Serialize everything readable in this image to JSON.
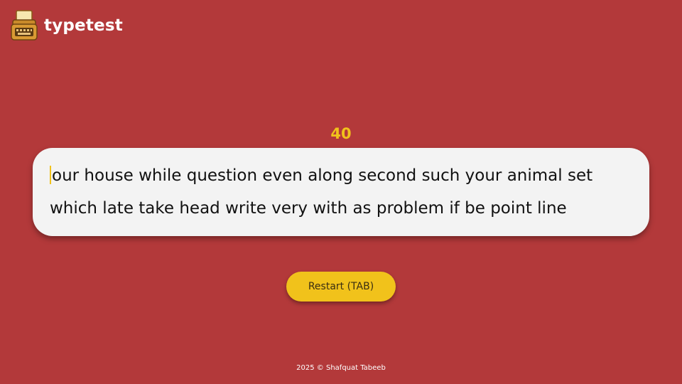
{
  "app": {
    "name": "typetest",
    "logo_icon": "typewriter-icon"
  },
  "timer": {
    "value": "40"
  },
  "typing_area": {
    "line1": "our house while question even along second such your animal set",
    "line2": "which late take head write very with as problem if be point line"
  },
  "controls": {
    "restart_label": "Restart (TAB)"
  },
  "footer": {
    "text": "2025 © Shafquat Tabeeb"
  },
  "colors": {
    "background": "#b3393a",
    "accent": "#f1c21b",
    "text_box": "#f3f3f3"
  }
}
